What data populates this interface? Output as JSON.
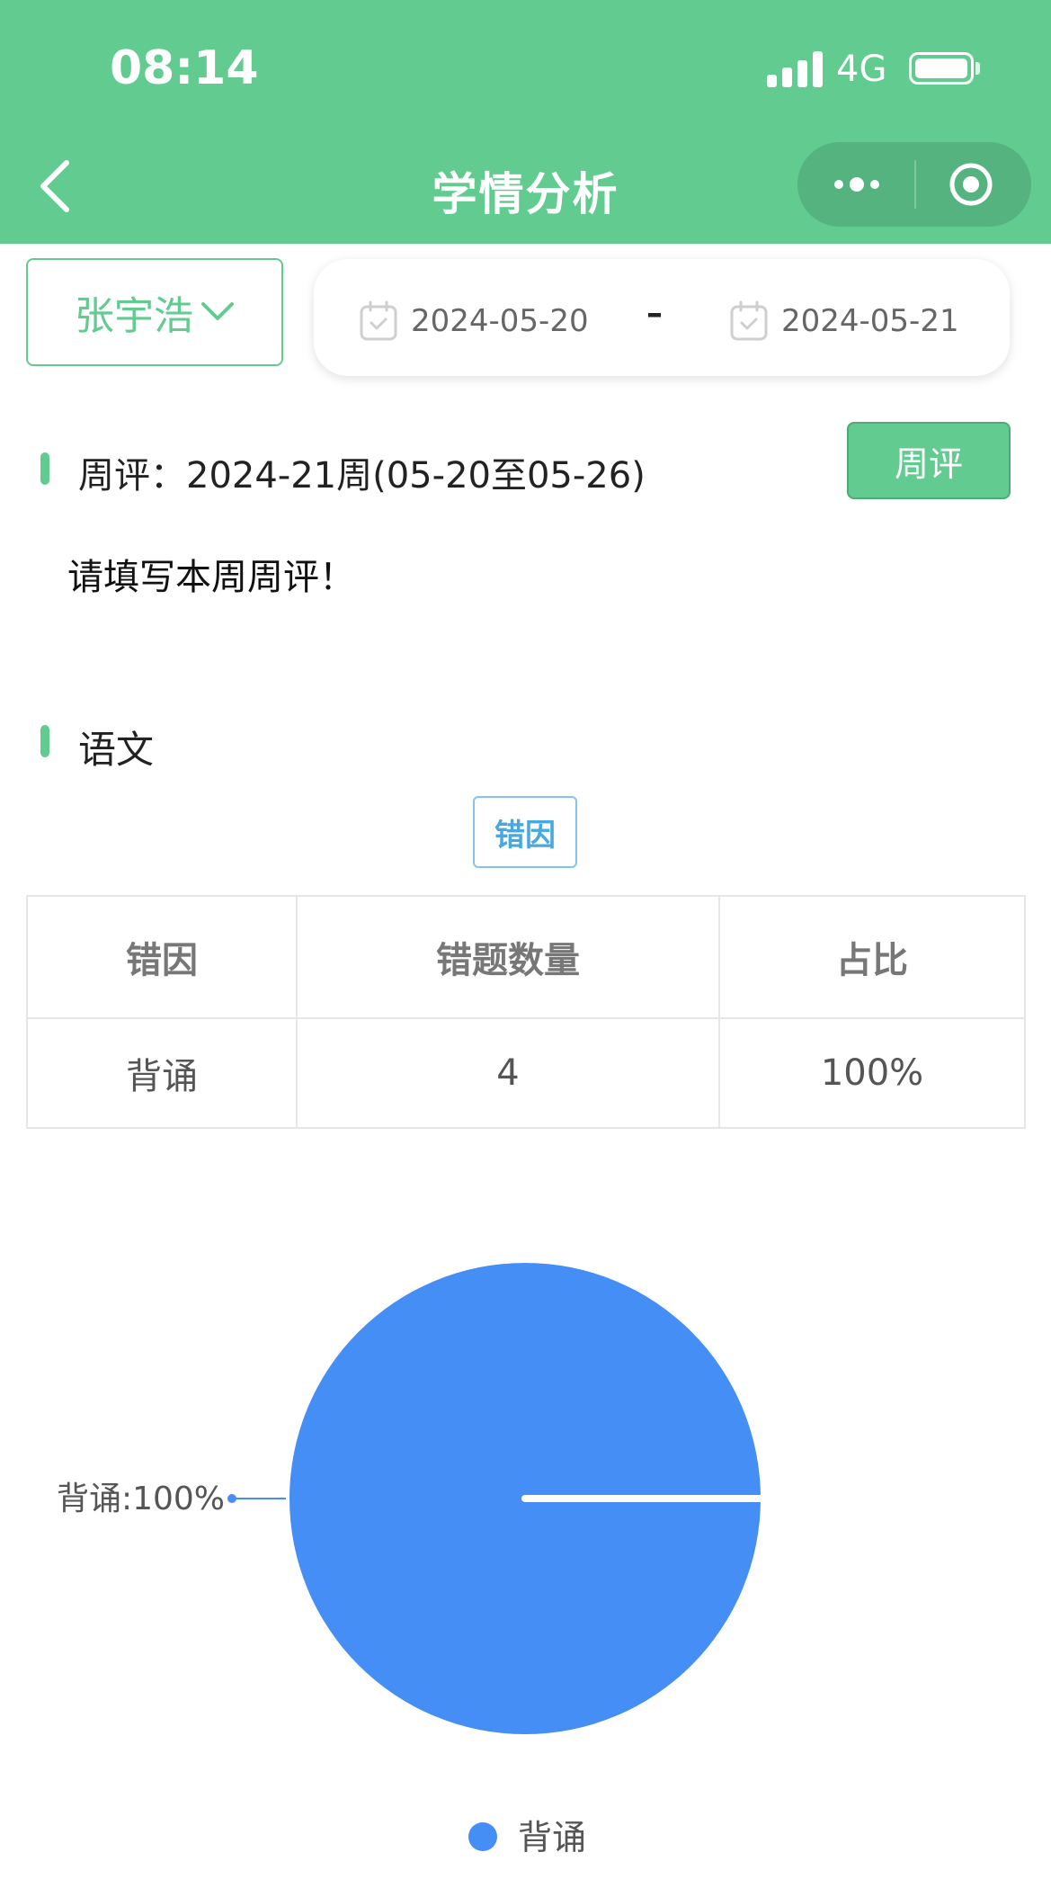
{
  "status_bar": {
    "time": "08:14",
    "network": "4G"
  },
  "header": {
    "title": "学情分析"
  },
  "filters": {
    "student": "张宇浩",
    "start_date": "2024-05-20",
    "separator": "–",
    "end_date": "2024-05-21"
  },
  "weekly_review": {
    "title": "周评：2024-21周(05-20至05-26)",
    "button_label": "周评",
    "content": "请填写本周周评！"
  },
  "subject": {
    "name": "语文",
    "tab_label": "错因",
    "table": {
      "headers": [
        "错因",
        "错题数量",
        "占比"
      ],
      "rows": [
        [
          "背诵",
          "4",
          "100%"
        ]
      ]
    }
  },
  "chart_data": {
    "type": "pie",
    "slices": [
      {
        "label": "背诵",
        "value": 4,
        "percent": 100,
        "color": "#448ef6"
      }
    ],
    "data_labels": [
      "背诵:100%"
    ],
    "legend": [
      "背诵"
    ],
    "legend_position": "bottom"
  }
}
